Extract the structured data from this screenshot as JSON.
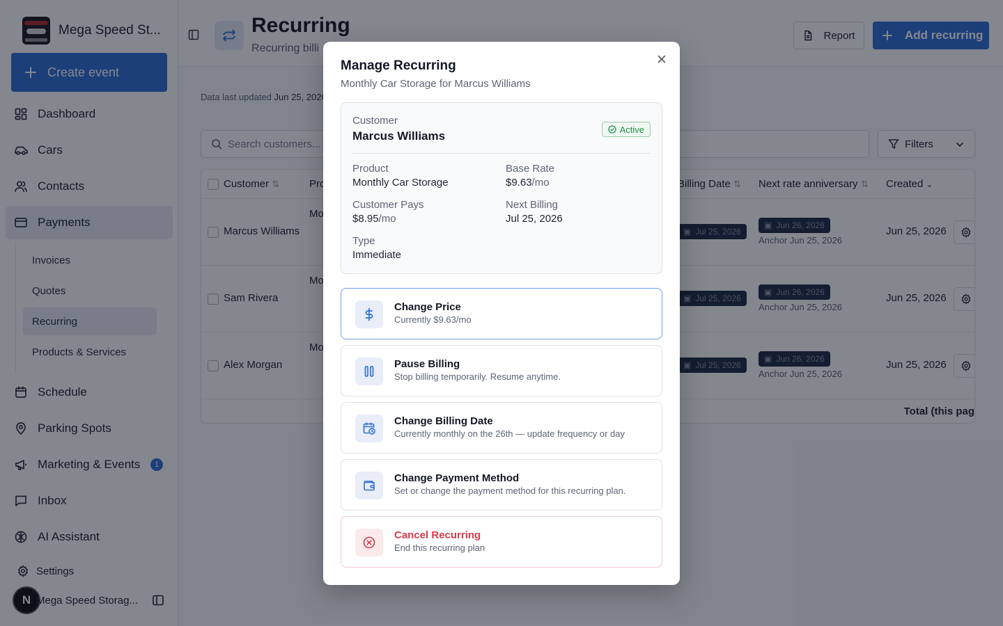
{
  "sidebar": {
    "brand": "Mega Speed St...",
    "create_event": "Create event",
    "nav": {
      "dashboard": "Dashboard",
      "cars": "Cars",
      "contacts": "Contacts",
      "payments": "Payments",
      "schedule": "Schedule",
      "parking": "Parking Spots",
      "marketing": "Marketing & Events",
      "marketing_badge": "1",
      "inbox": "Inbox",
      "ai": "AI Assistant"
    },
    "payments_sub": {
      "invoices": "Invoices",
      "quotes": "Quotes",
      "recurring": "Recurring",
      "products": "Products & Services"
    },
    "settings": "Settings",
    "user_initial": "N",
    "user_name": "Mega Speed Storag..."
  },
  "header": {
    "title": "Recurring",
    "subtitle": "Recurring billi",
    "report": "Report",
    "add": "Add recurring"
  },
  "main": {
    "updated_label": "Data last updated",
    "updated_value": "Jun 25, 2026,",
    "search_placeholder": "Search customers...",
    "filters": "Filters",
    "columns": {
      "customer": "Customer",
      "product": "Pro",
      "billing_date": "Billing Date",
      "next_rate": "Next rate anniversary",
      "created": "Created"
    },
    "rows": [
      {
        "customer": "Marcus Williams",
        "product": "Mo",
        "billing": "Jul 25, 2026",
        "next_rate": "Jun 26, 2026",
        "anchor": "Anchor Jun 25, 2026",
        "created": "Jun 25, 2026"
      },
      {
        "customer": "Sam Rivera",
        "product": "Mo",
        "billing": "Jul 25, 2026",
        "next_rate": "Jun 26, 2026",
        "anchor": "Anchor Jun 25, 2026",
        "created": "Jun 25, 2026"
      },
      {
        "customer": "Alex Morgan",
        "product": "Mo",
        "billing": "Jul 25, 2026",
        "next_rate": "Jun 26, 2026",
        "anchor": "Anchor Jun 25, 2026",
        "created": "Jun 25, 2026"
      }
    ],
    "total": "Total (this pag"
  },
  "modal": {
    "title": "Manage Recurring",
    "subtitle": "Monthly Car Storage for Marcus Williams",
    "customer_label": "Customer",
    "customer": "Marcus Williams",
    "status": "Active",
    "product_label": "Product",
    "product": "Monthly Car Storage",
    "base_rate_label": "Base Rate",
    "base_rate": "$9.63",
    "base_rate_unit": "/mo",
    "pays_label": "Customer Pays",
    "pays": "$8.95",
    "pays_unit": "/mo",
    "next_billing_label": "Next Billing",
    "next_billing": "Jul 25, 2026",
    "type_label": "Type",
    "type": "Immediate",
    "actions": {
      "change_price": {
        "title": "Change Price",
        "desc": "Currently $9.63/mo"
      },
      "pause": {
        "title": "Pause Billing",
        "desc": "Stop billing temporarily. Resume anytime."
      },
      "billing_date": {
        "title": "Change Billing Date",
        "desc": "Currently monthly on the 26th — update frequency or day"
      },
      "payment_method": {
        "title": "Change Payment Method",
        "desc": "Set or change the payment method for this recurring plan."
      },
      "cancel": {
        "title": "Cancel Recurring",
        "desc": "End this recurring plan"
      }
    }
  },
  "colors": {
    "accent": "#2f6fd6",
    "danger": "#d93a4a",
    "success": "#258a4a"
  }
}
